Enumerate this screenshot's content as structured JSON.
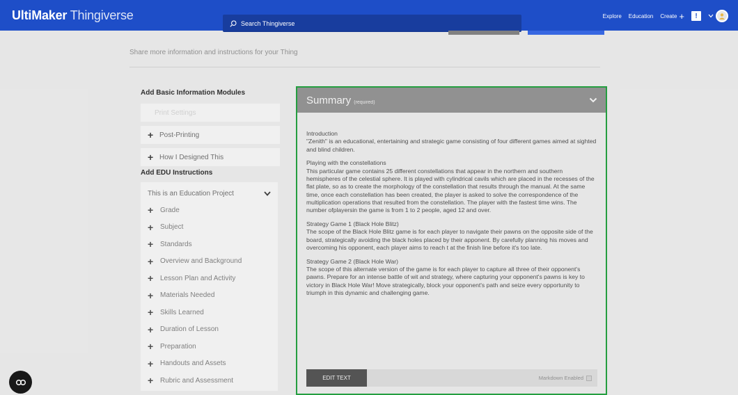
{
  "header": {
    "logo_bold": "UltiMaker",
    "logo_light": " Thingiverse",
    "search_placeholder": "Search Thingiverse",
    "links": {
      "explore": "Explore",
      "education": "Education",
      "create": "Create"
    },
    "notif_label": "!",
    "colors": {
      "bar": "#1e4ec8",
      "search": "#183d9e"
    }
  },
  "intro_text": "Share more information and instructions for your Thing",
  "left": {
    "basic_title": "Add Basic Information Modules",
    "basic_items": [
      {
        "label": "Print Settings",
        "faded": true
      },
      {
        "label": "Post-Printing",
        "faded": false
      },
      {
        "label": "How I Designed This",
        "faded": false
      }
    ],
    "edu_title": "Add EDU Instructions",
    "edu_select": "This is an Education Project",
    "edu_items": [
      "Grade",
      "Subject",
      "Standards",
      "Overview and Background",
      "Lesson Plan and Activity",
      "Materials Needed",
      "Skills Learned",
      "Duration of Lesson",
      "Preparation",
      "Handouts and Assets",
      "Rubric and Assessment"
    ]
  },
  "summary": {
    "title": "Summary",
    "required": "(required)",
    "paragraphs": [
      {
        "heading": "Introduction",
        "text": "\"Zenith\" is an educational, entertaining and strategic game consisting of four different games aimed at sighted and blind children."
      },
      {
        "heading": "Playing with the constellations",
        "text": "This particular game contains 25 different constellations that appear in the northern and southern hemispheres of the celestial sphere. It is played with cylindrical cavils which are placed in the recesses of the flat plate, so as to create the morphology of the constellation that results through the manual. At the same time, once each constellation has been created, the player is asked to solve the correspondence of the multiplication operations that resulted from the constellation. The player with the fastest time wins. The number ofplayersin the game is from 1 to 2 people, aged 12 and over."
      },
      {
        "heading": "Strategy Game 1 (Black Hole Blitz)",
        "text": "The scope of the Black Hole Blitz game is for each player to navigate their pawns on the opposite side of the board, strategically avoiding the black holes placed by their apponent. By carefully planning his moves and overcoming his opponent, each player aims to reach t at the finish line before it's too late."
      },
      {
        "heading": "Strategy Game 2 (Black Hole War)",
        "text": "The scope of this alternate version of the game is for each player to capture all three of their opponent's pawns. Prepare for an intense battle of wit and strategy, where capturing your opponent's pawns is key to victory in Black Hole War! Move strategically, block your opponent's path and seize every opportunity to triumph in this dynamic and challenging game."
      }
    ],
    "edit_button": "EDIT TEXT",
    "markdown_label": "Markdown Enabled",
    "border_color": "#27a844"
  }
}
